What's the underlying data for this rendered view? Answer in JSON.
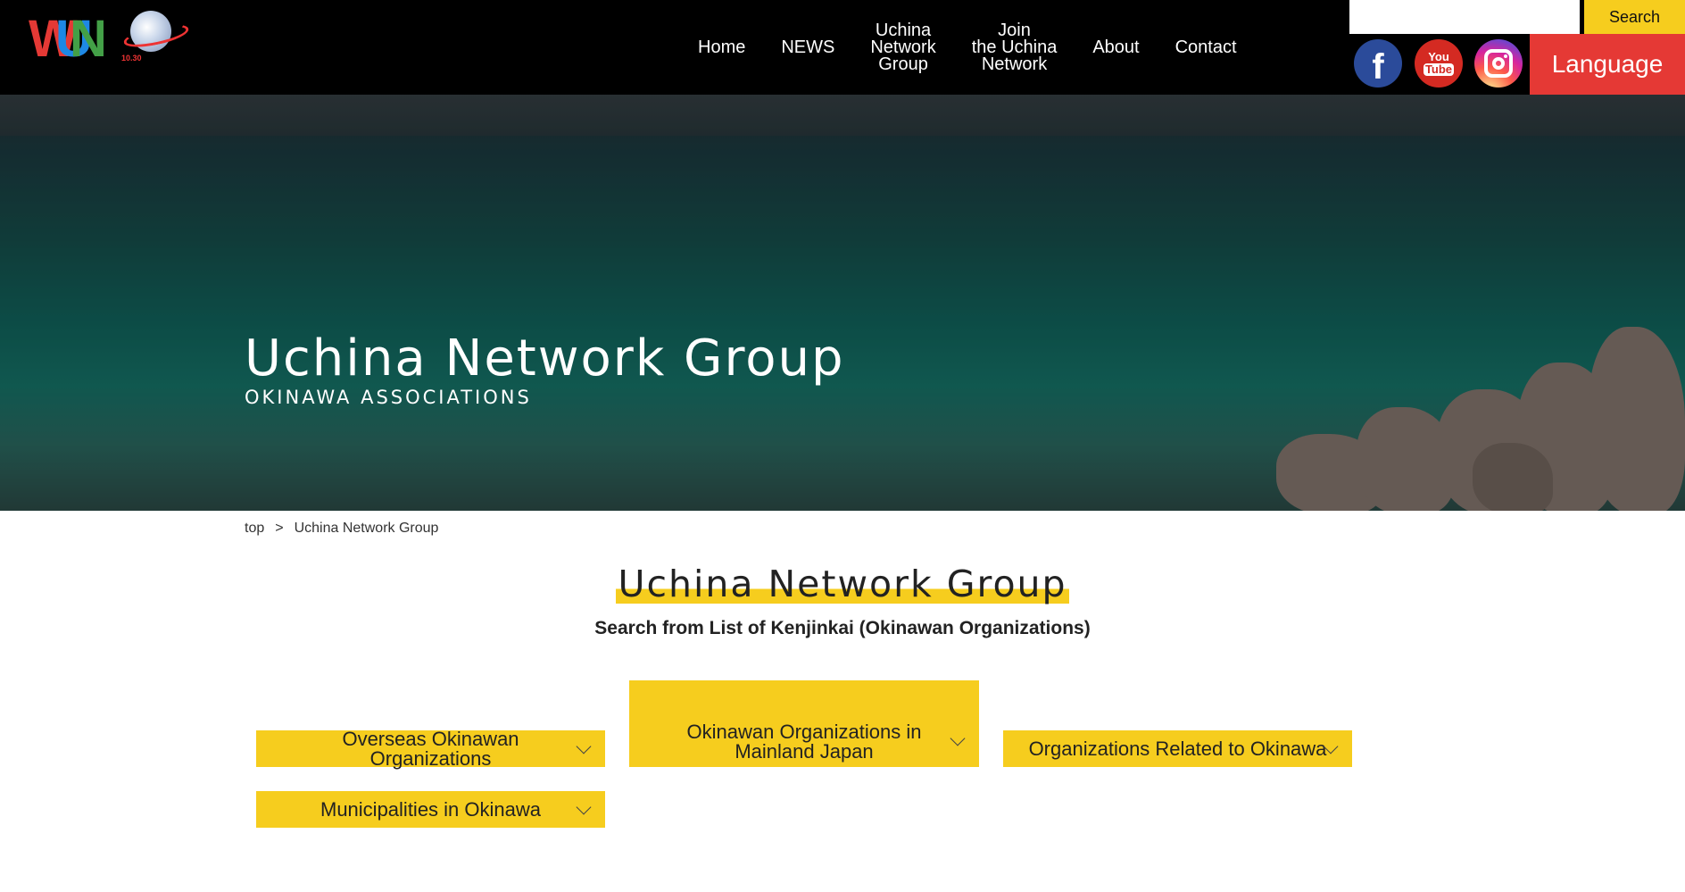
{
  "header": {
    "logo": {
      "wun_letters": [
        "W",
        "U",
        "N"
      ],
      "wun_colors": [
        "#e53935",
        "#1e88e5",
        "#43a047"
      ],
      "badge_text": "10.30"
    },
    "nav": [
      {
        "label": "Home"
      },
      {
        "label": "NEWS"
      },
      {
        "label": "Uchina\nNetwork\nGroup"
      },
      {
        "label": "Join\nthe Uchina\nNetwork"
      },
      {
        "label": "About"
      },
      {
        "label": "Contact"
      }
    ],
    "search": {
      "value": "",
      "placeholder": "",
      "button_label": "Search"
    },
    "social": [
      {
        "name": "facebook-icon",
        "glyph": "f"
      },
      {
        "name": "youtube-icon",
        "glyph_top": "You",
        "glyph_bottom": "Tube"
      },
      {
        "name": "instagram-icon"
      }
    ],
    "language_label": "Language"
  },
  "hero": {
    "title": "Uchina Network Group",
    "subtitle": "OKINAWA ASSOCIATIONS"
  },
  "breadcrumb": {
    "home": "top",
    "separator": ">",
    "current": "Uchina Network Group"
  },
  "main": {
    "title": "Uchina Network Group",
    "subtitle": "Search from List of Kenjinkai (Okinawan Organizations)",
    "categories": [
      {
        "label": "Overseas Okinawan Organizations"
      },
      {
        "label": "Okinawan Organizations in Mainland Japan"
      },
      {
        "label": "Organizations Related to Okinawa"
      },
      {
        "label": "Municipalities in Okinawa"
      }
    ]
  },
  "colors": {
    "header_bg": "#000000",
    "accent_yellow": "#f6cd1e",
    "language_red": "#e53935",
    "facebook_blue": "#2b4b9a",
    "youtube_red": "#d42a22"
  }
}
